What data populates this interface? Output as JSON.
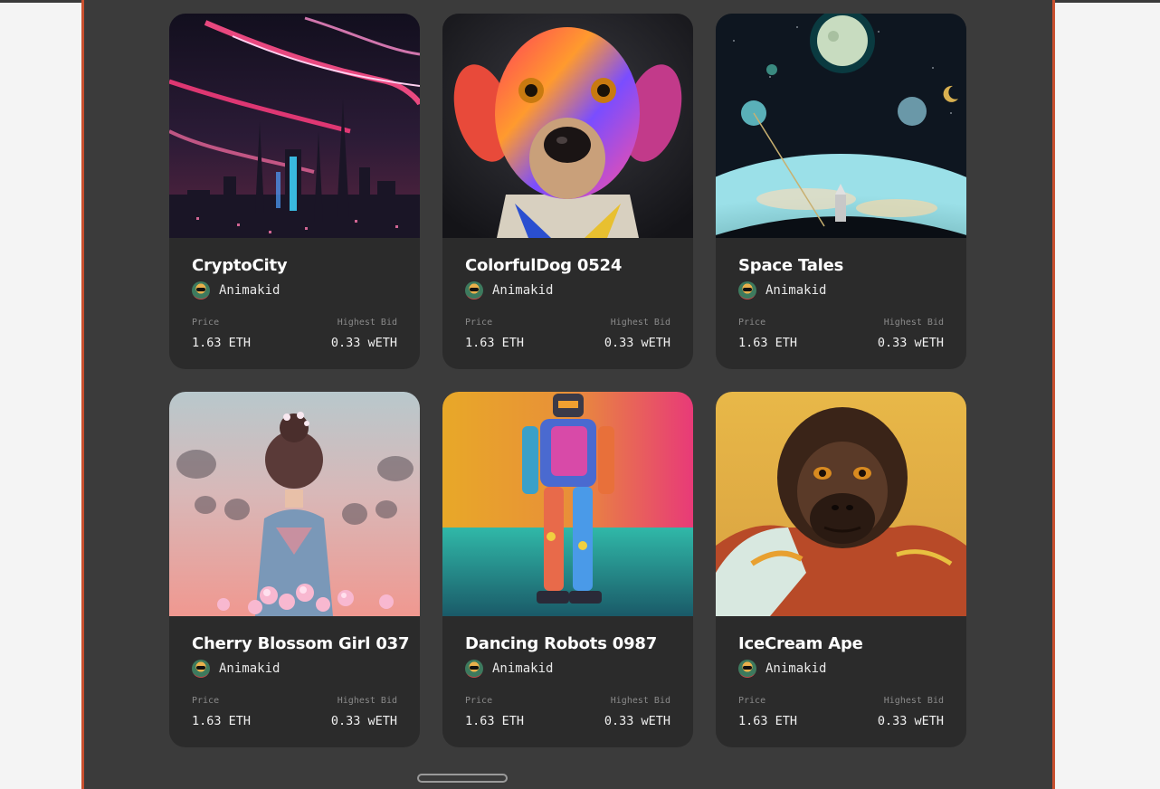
{
  "accent_color": "#c9502f",
  "cards": [
    {
      "title": "CryptoCity",
      "creator": "Animakid",
      "price_label": "Price",
      "price": "1.63 ETH",
      "bid_label": "Highest Bid",
      "bid": "0.33 wETH",
      "image": "neon-city-image"
    },
    {
      "title": "ColorfulDog 0524",
      "creator": "Animakid",
      "price_label": "Price",
      "price": "1.63 ETH",
      "bid_label": "Highest Bid",
      "bid": "0.33 wETH",
      "image": "colorful-dog-image"
    },
    {
      "title": "Space Tales",
      "creator": "Animakid",
      "price_label": "Price",
      "price": "1.63 ETH",
      "bid_label": "Highest Bid",
      "bid": "0.33 wETH",
      "image": "space-planet-image"
    },
    {
      "title": "Cherry Blossom Girl 037",
      "creator": "Animakid",
      "price_label": "Price",
      "price": "1.63 ETH",
      "bid_label": "Highest Bid",
      "bid": "0.33 wETH",
      "image": "blossom-girl-image"
    },
    {
      "title": "Dancing Robots 0987",
      "creator": "Animakid",
      "price_label": "Price",
      "price": "1.63 ETH",
      "bid_label": "Highest Bid",
      "bid": "0.33 wETH",
      "image": "robot-image"
    },
    {
      "title": "IceCream Ape",
      "creator": "Animakid",
      "price_label": "Price",
      "price": "1.63 ETH",
      "bid_label": "Highest Bid",
      "bid": "0.33 wETH",
      "image": "ape-image"
    }
  ]
}
